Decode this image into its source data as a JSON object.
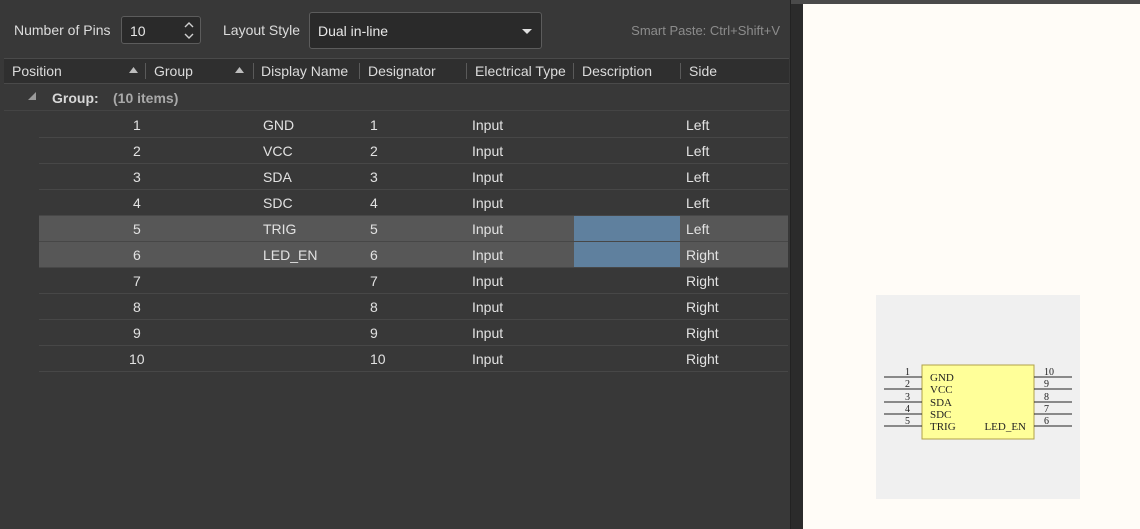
{
  "toolbar": {
    "num_pins_label": "Number of Pins",
    "num_pins_value": "10",
    "layout_label": "Layout Style",
    "layout_value": "Dual in-line",
    "smart_paste": "Smart Paste: Ctrl+Shift+V"
  },
  "columns": {
    "position": "Position",
    "group": "Group",
    "display_name": "Display Name",
    "designator": "Designator",
    "electrical_type": "Electrical Type",
    "description": "Description",
    "side": "Side"
  },
  "group_row": {
    "label": "Group:",
    "count": "(10 items)"
  },
  "pins": [
    {
      "position": "1",
      "display_name": "GND",
      "designator": "1",
      "electrical_type": "Input",
      "side": "Left"
    },
    {
      "position": "2",
      "display_name": "VCC",
      "designator": "2",
      "electrical_type": "Input",
      "side": "Left"
    },
    {
      "position": "3",
      "display_name": "SDA",
      "designator": "3",
      "electrical_type": "Input",
      "side": "Left"
    },
    {
      "position": "4",
      "display_name": "SDC",
      "designator": "4",
      "electrical_type": "Input",
      "side": "Left"
    },
    {
      "position": "5",
      "display_name": "TRIG",
      "designator": "5",
      "electrical_type": "Input",
      "side": "Left"
    },
    {
      "position": "6",
      "display_name": "LED_EN",
      "designator": "6",
      "electrical_type": "Input",
      "side": "Right"
    },
    {
      "position": "7",
      "display_name": "",
      "designator": "7",
      "electrical_type": "Input",
      "side": "Right"
    },
    {
      "position": "8",
      "display_name": "",
      "designator": "8",
      "electrical_type": "Input",
      "side": "Right"
    },
    {
      "position": "9",
      "display_name": "",
      "designator": "9",
      "electrical_type": "Input",
      "side": "Right"
    },
    {
      "position": "10",
      "display_name": "",
      "designator": "10",
      "electrical_type": "Input",
      "side": "Right"
    }
  ],
  "preview": {
    "left_pins": [
      {
        "num": "1",
        "name": "GND"
      },
      {
        "num": "2",
        "name": "VCC"
      },
      {
        "num": "3",
        "name": "SDA"
      },
      {
        "num": "4",
        "name": "SDC"
      },
      {
        "num": "5",
        "name": "TRIG"
      }
    ],
    "right_pins": [
      {
        "num": "10",
        "name": ""
      },
      {
        "num": "9",
        "name": ""
      },
      {
        "num": "8",
        "name": ""
      },
      {
        "num": "7",
        "name": ""
      },
      {
        "num": "6",
        "name": "LED_EN"
      }
    ]
  },
  "colors": {
    "selection": "#575757",
    "description_highlight": "#5f809e",
    "component_body": "#ffff99"
  }
}
